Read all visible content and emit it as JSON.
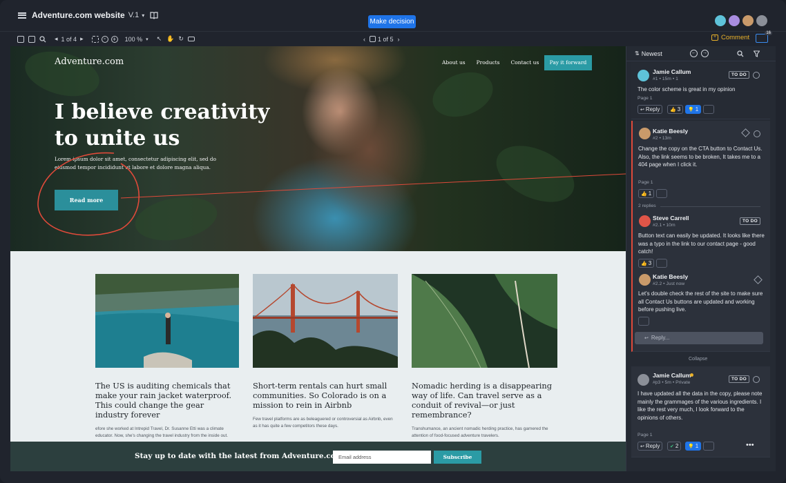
{
  "app": {
    "title": "Adventure.com website",
    "version": "V.1",
    "make_decision": "Make decision",
    "page_nav": "1 of 4",
    "zoom": "100 %",
    "page_indicator": "1 of 5",
    "comment_label": "Comment",
    "notif_count": "16"
  },
  "site": {
    "logo": "Adventure.com",
    "nav": [
      "About us",
      "Products",
      "Contact us"
    ],
    "cta": "Pay it forward",
    "hero_title": "I believe creativity to unite us",
    "hero_body": "Lorem ipsum dolor sit amet, consectetur adipiscing elit, sed do eiusmod tempor incididunt ut labore et dolore magna aliqua.",
    "read_more": "Read more",
    "cards": [
      {
        "title": "The US is auditing chemicals that make your rain jacket waterproof. This could change the gear industry forever",
        "desc": "efore she worked at Intrepid Travel, Dr. Susanne Etti was a climate educator. Now, she's changing the travel industry from the inside out."
      },
      {
        "title": "Short-term rentals can hurt small communities. So Colorado is on a mission to rein in Airbnb",
        "desc": "Few travel platforms are as beleaguered or controversial as Airbnb, even as it has quite a few competitors these days."
      },
      {
        "title": "Nomadic herding is a disappearing way of life. Can travel serve as a conduit of revival—or just remembrance?",
        "desc": "Transhumance, an ancient nomadic herding practice, has garnered the attention of food-focused adventure travelers."
      }
    ],
    "subscribe_text": "Stay up to date with the latest from Adventure.com",
    "email_placeholder": "Email address",
    "subscribe_btn": "Subscribe"
  },
  "panel": {
    "sort": "Newest",
    "comments": [
      {
        "name": "Jamie Callum",
        "meta": "#1 • 15m • 1",
        "tag": "TO DO",
        "text": "The color scheme is great in my opinion",
        "page": "Page 1",
        "reply": "Reply",
        "likes": "3",
        "ideas": "1"
      },
      {
        "name": "Katie Beesly",
        "meta": "#2 • 13m",
        "text": "Change the copy on the CTA button to Contact Us. Also, the link seems to be broken, It takes me to a 404 page when I click it.",
        "page": "Page 1",
        "likes": "1",
        "replies_label": "2 replies"
      },
      {
        "name": "Steve Carrell",
        "meta": "#2.1 • 10m",
        "tag": "TO DO",
        "text": "Button text can easily be updated. It looks like there was a typo in the link to our contact page - good catch!",
        "likes": "3"
      },
      {
        "name": "Katie Beesly",
        "meta": "#2.2 • Just now",
        "text": "Let's double check the rest of the site to make sure all Contact Us buttons are updated and working before pushing live."
      },
      {
        "name": "Jamie Callum",
        "meta": "#p3 • 5m • Private",
        "tag": "TO DO",
        "text": "I have updated all the data in the copy, please note mainly the grammages of the various ingredients. I like the rest very much, I look forward to the opinions of others.",
        "page": "Page 1",
        "reply": "Reply",
        "checks": "2",
        "ideas": "1"
      }
    ],
    "reply_placeholder": "Reply...",
    "collapse": "Collapse"
  },
  "colors": {
    "accent_blue": "#1f74e8",
    "teal": "#2b9ba5",
    "todo_border": "#8a909b",
    "annotation_red": "#e04a3a",
    "comment_gold": "#e9b12a"
  }
}
